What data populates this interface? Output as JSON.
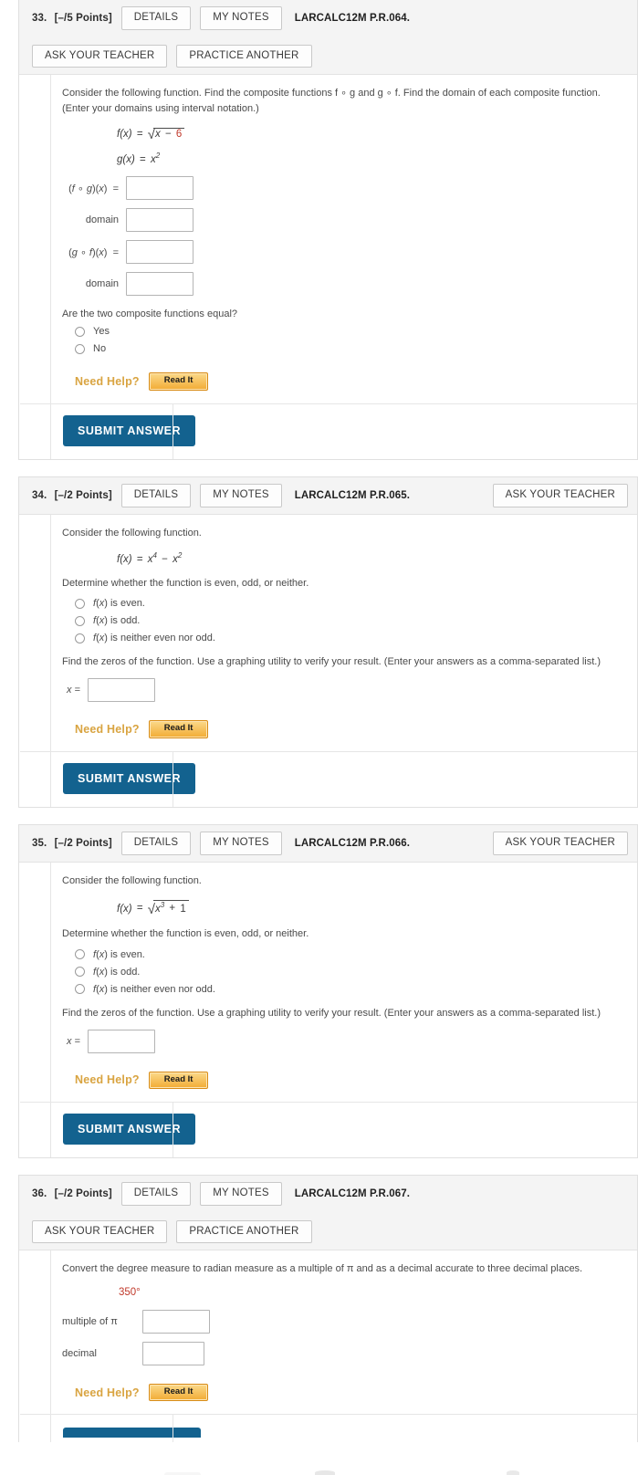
{
  "labels": {
    "details": "DETAILS",
    "my_notes": "MY NOTES",
    "ask_teacher": "ASK YOUR TEACHER",
    "practice_another": "PRACTICE ANOTHER",
    "need_help": "Need Help?",
    "read_it": "Read It",
    "submit": "SUBMIT ANSWER",
    "domain": "domain",
    "x_eq": "x =",
    "multiple_of_pi": "multiple of π",
    "decimal": "decimal"
  },
  "colors": {
    "submit_blue": "#13628f",
    "need_help_orange": "#d9a441",
    "read_it_gradient_top": "#fbd98a",
    "read_it_gradient_bottom": "#f2ab34",
    "red_value": "#c0392b",
    "header_bg": "#f4f4f4"
  },
  "problems": [
    {
      "number": "33.",
      "points": "[–/5 Points]",
      "code": "LARCALC12M P.R.064.",
      "header_buttons_row1": [
        "DETAILS",
        "MY NOTES"
      ],
      "header_buttons_row2": [
        "ASK YOUR TEACHER",
        "PRACTICE ANOTHER"
      ],
      "question": "Consider the following function. Find the composite functions f ∘ g and g ∘ f. Find the domain of each composite function. (Enter your domains using interval notation.)",
      "formulas": [
        "f(x) = √(x − 6)",
        "g(x) = x²"
      ],
      "answer_rows": [
        {
          "label": "(f ∘ g)(x)  =",
          "value": ""
        },
        {
          "label": "domain",
          "value": ""
        },
        {
          "label": "(g ∘ f)(x)  =",
          "value": ""
        },
        {
          "label": "domain",
          "value": ""
        }
      ],
      "prompt": "Are the two composite functions equal?",
      "radios": [
        "Yes",
        "No"
      ]
    },
    {
      "number": "34.",
      "points": "[–/2 Points]",
      "code": "LARCALC12M P.R.065.",
      "header_buttons_row1": [
        "DETAILS",
        "MY NOTES"
      ],
      "header_buttons_row2": [
        "ASK YOUR TEACHER"
      ],
      "question": "Consider the following function.",
      "formula": "f(x) = x⁴ − x²",
      "prompt": "Determine whether the function is even, odd, or neither.",
      "radios": [
        "f(x) is even.",
        "f(x) is odd.",
        "f(x) is neither even nor odd."
      ],
      "zeros_prompt": "Find the zeros of the function. Use a graphing utility to verify your result. (Enter your answers as a comma-separated list.)",
      "zeros_value": ""
    },
    {
      "number": "35.",
      "points": "[–/2 Points]",
      "code": "LARCALC12M P.R.066.",
      "header_buttons_row1": [
        "DETAILS",
        "MY NOTES"
      ],
      "header_buttons_row2": [
        "ASK YOUR TEACHER"
      ],
      "question": "Consider the following function.",
      "formula": "f(x) = √(x³ + 1)",
      "prompt": "Determine whether the function is even, odd, or neither.",
      "radios": [
        "f(x) is even.",
        "f(x) is odd.",
        "f(x) is neither even nor odd."
      ],
      "zeros_prompt": "Find the zeros of the function. Use a graphing utility to verify your result. (Enter your answers as a comma-separated list.)",
      "zeros_value": ""
    },
    {
      "number": "36.",
      "points": "[–/2 Points]",
      "code": "LARCALC12M P.R.067.",
      "header_buttons_row1": [
        "DETAILS",
        "MY NOTES"
      ],
      "header_buttons_row2": [
        "ASK YOUR TEACHER",
        "PRACTICE ANOTHER"
      ],
      "question": "Convert the degree measure to radian measure as a multiple of π and as a decimal accurate to three decimal places.",
      "degree_value": "350°",
      "answer_rows": [
        {
          "label": "multiple of π",
          "value": ""
        },
        {
          "label": "decimal",
          "value": ""
        }
      ]
    }
  ]
}
